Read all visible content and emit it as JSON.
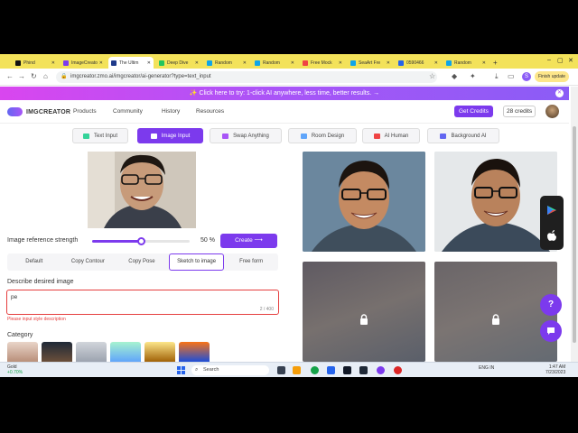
{
  "browser": {
    "tabs": [
      {
        "label": "Phind",
        "color": "#111111",
        "active": false
      },
      {
        "label": "ImageCreator",
        "color": "#7c3aed",
        "active": false
      },
      {
        "label": "The Ultim",
        "color": "#1e3a8a",
        "active": true
      },
      {
        "label": "Deep Dive",
        "color": "#22c55e",
        "active": false
      },
      {
        "label": "Random",
        "color": "#0ea5e9",
        "active": false
      },
      {
        "label": "Random",
        "color": "#0ea5e9",
        "active": false
      },
      {
        "label": "Free Mock",
        "color": "#ef4444",
        "active": false
      },
      {
        "label": "SeaArt Fre",
        "color": "#0ea5e9",
        "active": false
      },
      {
        "label": "0590466",
        "color": "#2563eb",
        "active": false
      },
      {
        "label": "Random",
        "color": "#0ea5e9",
        "active": false
      }
    ],
    "new_tab": "+",
    "url": "imgcreator.zmo.ai/imgcreator/ai-generator?type=text_input",
    "profile_initial": "S",
    "finish_update": "Finish update"
  },
  "banner": {
    "text": "✨ Click here to try: 1-click AI anywhere, less time, better results. →",
    "close": "✕"
  },
  "site": {
    "logo": "IMGCREATOR",
    "nav": [
      "Products",
      "Community",
      "History",
      "Resources"
    ],
    "get_credits": "Get Credits",
    "credits": "28 credits"
  },
  "modes": [
    {
      "label": "Text Input",
      "color": "#34d399",
      "active": false
    },
    {
      "label": "Image Input",
      "color": "#ffffff",
      "active": true
    },
    {
      "label": "Swap Anything",
      "color": "#a855f7",
      "active": false
    },
    {
      "label": "Room Design",
      "color": "#60a5fa",
      "active": false
    },
    {
      "label": "AI Human",
      "color": "#ef4444",
      "active": false
    },
    {
      "label": "Background AI",
      "color": "#6366f1",
      "active": false
    }
  ],
  "controls": {
    "strength_label": "Image reference strength",
    "strength_value": "50 %",
    "strength_fraction": 0.5,
    "create": "Create ⟶",
    "segments": [
      "Default",
      "Copy Contour",
      "Copy Pose",
      "Sketch to image",
      "Free form"
    ],
    "active_segment": 3,
    "describe_label": "Describe desired image",
    "describe_value": "pe",
    "describe_count": "2 / 400",
    "describe_error": "Please input style description",
    "category_label": "Category"
  },
  "taskbar": {
    "weather_title": "Gold",
    "weather_change": "+0.70%",
    "search": "Search",
    "tray": "ENG IN",
    "time": "1:47 AM",
    "date": "7/23/2023"
  }
}
